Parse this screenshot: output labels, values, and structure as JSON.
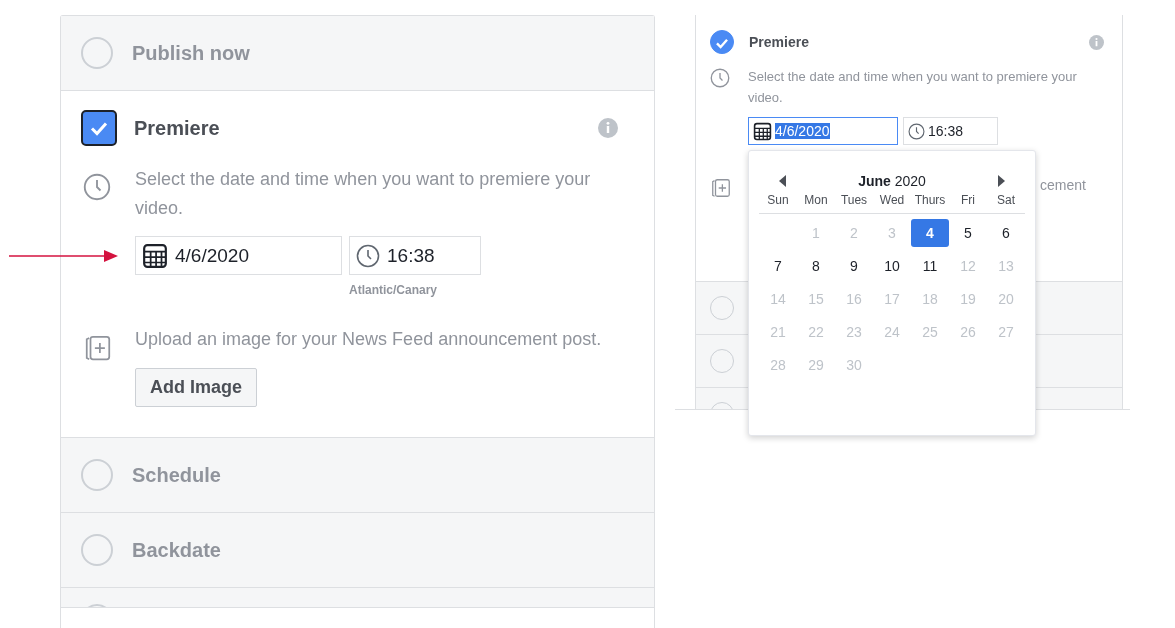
{
  "left_panel": {
    "options": [
      {
        "label": "Publish now",
        "selected": false,
        "focused": false
      },
      {
        "label": "Premiere",
        "selected": true,
        "focused": true
      },
      {
        "label": "Schedule",
        "selected": false,
        "focused": false
      },
      {
        "label": "Backdate",
        "selected": false,
        "focused": false
      }
    ],
    "premiere": {
      "description": "Select the date and time when you want to premiere your video.",
      "date": "4/6/2020",
      "time": "16:38",
      "timezone": "Atlantic/Canary",
      "upload_text": "Upload an image for your News Feed announcement post.",
      "button": "Add Image"
    }
  },
  "right_panel": {
    "title": "Premiere",
    "selected": true,
    "description": "Select the date and time when you want to premiere your video.",
    "date": "4/6/2020",
    "date_text_selected": true,
    "time": "16:38",
    "upload_text_fragment": "cement",
    "hidden_options": [
      {
        "selected": false
      },
      {
        "selected": false
      },
      {
        "selected": false
      }
    ],
    "calendar": {
      "month": "June",
      "year": "2020",
      "weekdays": [
        "Sun",
        "Mon",
        "Tues",
        "Wed",
        "Thurs",
        "Fri",
        "Sat"
      ],
      "weeks": [
        [
          {
            "day": "1",
            "disabled": true,
            "selected": false
          },
          {
            "day": "2",
            "disabled": true,
            "selected": false
          },
          {
            "day": "3",
            "disabled": true,
            "selected": false
          },
          {
            "day": "4",
            "disabled": false,
            "selected": true
          },
          {
            "day": "5",
            "disabled": false,
            "selected": false
          },
          {
            "day": "6",
            "disabled": false,
            "selected": false
          }
        ],
        [
          {
            "day": "7",
            "disabled": false,
            "selected": false
          },
          {
            "day": "8",
            "disabled": false,
            "selected": false
          },
          {
            "day": "9",
            "disabled": false,
            "selected": false
          },
          {
            "day": "10",
            "disabled": false,
            "selected": false
          },
          {
            "day": "11",
            "disabled": false,
            "selected": false
          },
          {
            "day": "12",
            "disabled": true,
            "selected": false
          },
          {
            "day": "13",
            "disabled": true,
            "selected": false
          }
        ],
        [
          {
            "day": "14",
            "disabled": true,
            "selected": false
          },
          {
            "day": "15",
            "disabled": true,
            "selected": false
          },
          {
            "day": "16",
            "disabled": true,
            "selected": false
          },
          {
            "day": "17",
            "disabled": true,
            "selected": false
          },
          {
            "day": "18",
            "disabled": true,
            "selected": false
          },
          {
            "day": "19",
            "disabled": true,
            "selected": false
          },
          {
            "day": "20",
            "disabled": true,
            "selected": false
          }
        ],
        [
          {
            "day": "21",
            "disabled": true,
            "selected": false
          },
          {
            "day": "22",
            "disabled": true,
            "selected": false
          },
          {
            "day": "23",
            "disabled": true,
            "selected": false
          },
          {
            "day": "24",
            "disabled": true,
            "selected": false
          },
          {
            "day": "25",
            "disabled": true,
            "selected": false
          },
          {
            "day": "26",
            "disabled": true,
            "selected": false
          },
          {
            "day": "27",
            "disabled": true,
            "selected": false
          }
        ],
        [
          {
            "day": "28",
            "disabled": true,
            "selected": false
          },
          {
            "day": "29",
            "disabled": true,
            "selected": false
          },
          {
            "day": "30",
            "disabled": true,
            "selected": false
          }
        ]
      ]
    }
  }
}
